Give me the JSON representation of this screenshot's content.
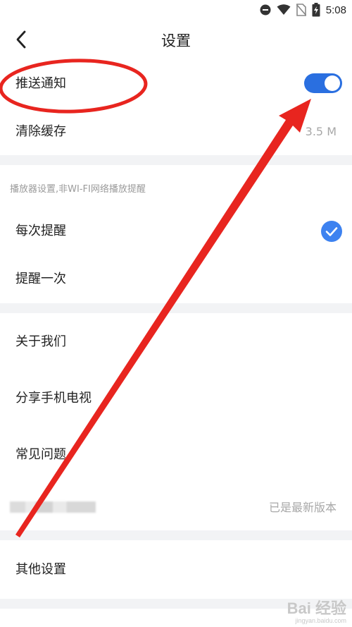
{
  "status_bar": {
    "time": "5:08",
    "icons": [
      "do-not-disturb-icon",
      "wifi-icon",
      "no-sim-icon",
      "battery-charging-icon"
    ]
  },
  "header": {
    "title": "设置",
    "back_icon": "chevron-left-icon"
  },
  "settings": {
    "push_notification": {
      "label": "推送通知",
      "enabled": true
    },
    "clear_cache": {
      "label": "清除缓存",
      "value": "3.5 M"
    }
  },
  "player_section": {
    "title": "播放器设置,非WI-FI网络播放提醒",
    "options": [
      {
        "label": "每次提醒",
        "selected": true
      },
      {
        "label": "提醒一次",
        "selected": false
      }
    ]
  },
  "about_section": {
    "about_us": "关于我们",
    "share_tv": "分享手机电视",
    "faq": "常见问题",
    "version_status": "已是最新版本"
  },
  "other_section": {
    "other_settings": "其他设置"
  },
  "colors": {
    "accent": "#2a6fe0",
    "annotation": "#e8251f",
    "divider": "#f2f3f5"
  },
  "watermark": {
    "logo_text": "Bai 经验",
    "site": "jingyan.baidu.com"
  }
}
